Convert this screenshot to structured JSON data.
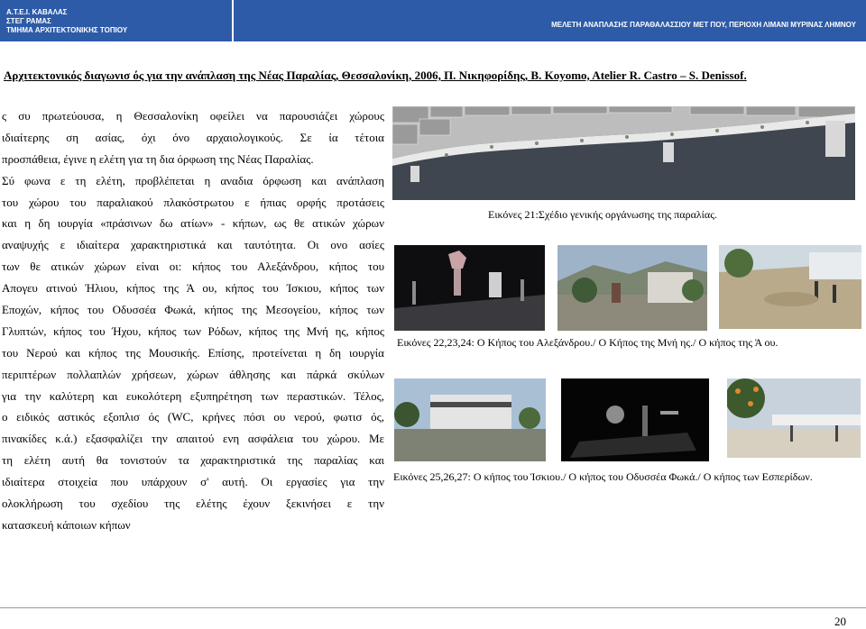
{
  "header": {
    "left_lines": [
      "Α.Τ.Ε.Ι. ΚΑΒΑΛΑΣ",
      "ΣΤΕΓ ΡΑΜΑΣ",
      "ΤΜΗΜΑ ΑΡΧΙΤΕΚΤΟΝΙΚΗΣ ΤΟΠΙΟΥ"
    ],
    "project": "ΜΕΛΕΤΗ ΑΝΑΠΛΑΣΗΣ ΠΑΡΑΘΑΛΑΣΣΙΟΥ ΜΕΤ ΠΟΥ, ΠΕΡΙΟΧΗ ΛΙΜΑΝΙ ΜΥΡΙΝΑΣ ΛΗΜΝΟΥ",
    "color": "#2d5ba8"
  },
  "title": "Αρχιτεκτονικός διαγωνισ ός για την ανάπλαση της Νέας Παραλίας, Θεσσαλονίκη, 2006, Π. Νικηφορίδης, Β. Koyomo, Atelier R. Castro – S. Denissof.",
  "body_lines": [
    "ς συ πρωτεύουσα, η Θεσσαλονίκη οφείλει να παρουσιάζει χώρους",
    "ιδιαίτερης ση ασίας, όχι όνο αρχαιολογικούς. Σε ία τέτοια",
    "προσπάθεια, έγινε η ελέτη για τη δια όρφωση της Νέας Παραλίας.",
    "Σύ φωνα ε τη ελέτη, προβλέπεται η αναδια όρφωση και ανάπλαση",
    "του χώρου του παραλιακού πλακόστρωτου ε ήπιας ορφής προτάσεις",
    "και η δη ιουργία «πράσινων δω ατίων» - κήπων, ως θε ατικών χώρων",
    "αναψυχής ε ιδιαίτερα χαρακτηριστικά και ταυτότητα. Οι ονο ασίες",
    "των θε ατικών χώρων είναι οι: κήπος του Αλεξάνδρου, κήπος του",
    "Απογευ ατινού Ήλιου, κήπος της Ά ου, κήπος του Ίσκιου, κήπος των",
    "Εποχών, κήπος του Οδυσσέα Φωκά, κήπος της Μεσογείου, κήπος των",
    "Γλυπτών, κήπος του Ήχου, κήπος των Ρόδων, κήπος της Μνή ης, κήπος",
    "του Νερού και κήπος της Μουσικής. Επίσης, προτείνεται η δη ιουργία",
    "περιπτέρων πολλαπλών χρήσεων, χώρων άθλησης και πάρκά σκύλων",
    "για την καλύτερη και ευκολότερη εξυπηρέτηση των περαστικών. Τέλος,",
    "ο ειδικός αστικός εξοπλισ ός (WC, κρήνες πόσι ου νερού, φωτισ ός,",
    "πινακίδες κ.ά.) εξασφαλίζει την απαιτού ενη ασφάλεια του χώρου. Με",
    "τη ελέτη αυτή θα τονιστούν τα χαρακτηριστικά της παραλίας και",
    "ιδιαίτερα στοιχεία που υπάρχουν σ' αυτή. Οι εργασίες για την",
    "ολοκλήρωση του σχεδίου της ελέτης έχουν ξεκινήσει ε την",
    "κατασκευή κάποιων κήπων"
  ],
  "captions": {
    "plan": "Εικόνες 21:Σχέδιο γενικής οργάνωσης της παραλίας.",
    "row1": "Εικόνες 22,23,24: Ο Κήπος του Αλεξάνδρου./ Ο Κήπος της Μνή ης./ Ο κήπος της Ά ου.",
    "row2": "Εικόνες 25,26,27: Ο κήπος του Ίσκιου./ Ο κήπος του Οδυσσέα Φωκά./ Ο κήπος των Εσπερίδων."
  },
  "page_number": "20"
}
